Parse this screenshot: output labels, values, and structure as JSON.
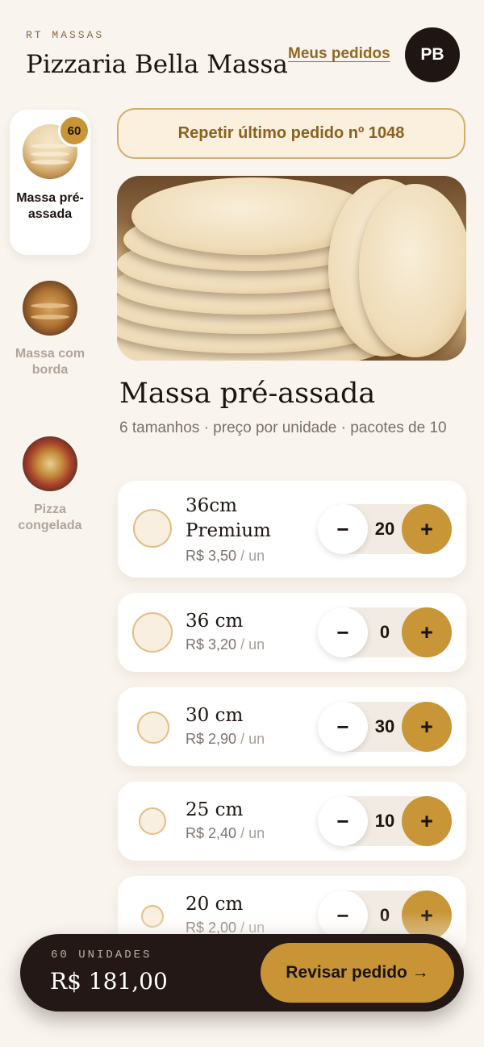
{
  "header": {
    "kicker": "RT MASSAS",
    "title": "Pizzaria Bella Massa",
    "orders_link": "Meus pedidos",
    "avatar_initials": "PB"
  },
  "categories": [
    {
      "label": "Massa pré-assada",
      "badge": "60",
      "active": true,
      "icon": "dough-stack-thumbnail"
    },
    {
      "label": "Massa com borda",
      "active": false,
      "icon": "bordered-crust-thumbnail"
    },
    {
      "label": "Pizza congelada",
      "active": false,
      "icon": "frozen-pizza-thumbnail"
    }
  ],
  "repeat_button": "Repetir último pedido nº 1048",
  "section": {
    "title": "Massa pré-assada",
    "subtitle": "6 tamanhos · preço por unidade · pacotes de 10"
  },
  "products": [
    {
      "name": "36cm Premium",
      "price": "R$ 3,50",
      "unit": "/ un",
      "qty": "20"
    },
    {
      "name": "36 cm",
      "price": "R$ 3,20",
      "unit": "/ un",
      "qty": "0"
    },
    {
      "name": "30 cm",
      "price": "R$ 2,90",
      "unit": "/ un",
      "qty": "30"
    },
    {
      "name": "25 cm",
      "price": "R$ 2,40",
      "unit": "/ un",
      "qty": "10"
    },
    {
      "name": "20 cm",
      "price": "R$ 2,00",
      "unit": "/ un",
      "qty": "0"
    }
  ],
  "stepper": {
    "minus": "−",
    "plus": "+"
  },
  "cart": {
    "count_label": "60 UNIDADES",
    "total": "R$ 181,00",
    "review_button": "Revisar pedido →"
  },
  "colors": {
    "background": "#f9f4ee",
    "accent": "#c89537",
    "dark": "#231815",
    "link": "#8f6a23"
  }
}
